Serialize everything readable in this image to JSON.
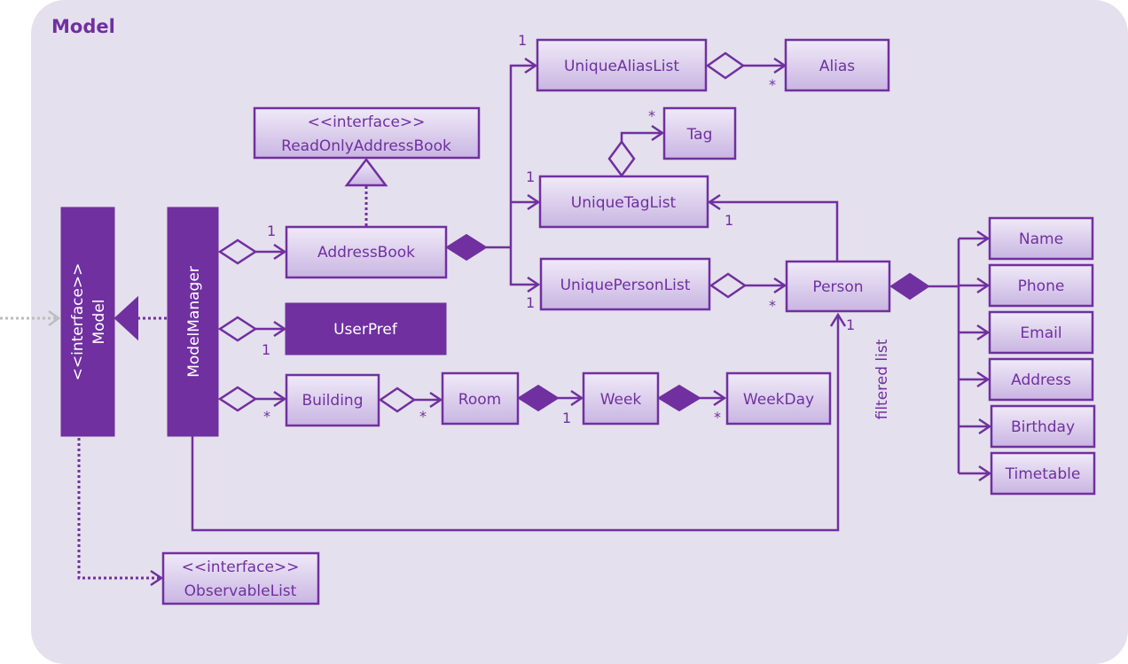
{
  "package": {
    "title": "Model"
  },
  "colors": {
    "accent": "#7030a0",
    "package_bg": "#e5e0ed",
    "box_top": "#f0eaf8",
    "box_bottom": "#c9b5e2",
    "external_arrow": "#bdbdbd"
  },
  "classes": {
    "model": {
      "stereotype": "<<interface>>",
      "name": "Model"
    },
    "model_manager": {
      "name": "ModelManager"
    },
    "read_only_address_book": {
      "stereotype": "<<interface>>",
      "name": "ReadOnlyAddressBook"
    },
    "address_book": {
      "name": "AddressBook"
    },
    "user_pref": {
      "name": "UserPref"
    },
    "building": {
      "name": "Building"
    },
    "room": {
      "name": "Room"
    },
    "week": {
      "name": "Week"
    },
    "week_day": {
      "name": "WeekDay"
    },
    "unique_alias_list": {
      "name": "UniqueAliasList"
    },
    "alias": {
      "name": "Alias"
    },
    "tag": {
      "name": "Tag"
    },
    "unique_tag_list": {
      "name": "UniqueTagList"
    },
    "unique_person_list": {
      "name": "UniquePersonList"
    },
    "person": {
      "name": "Person"
    },
    "name": {
      "name": "Name"
    },
    "phone": {
      "name": "Phone"
    },
    "email": {
      "name": "Email"
    },
    "address": {
      "name": "Address"
    },
    "birthday": {
      "name": "Birthday"
    },
    "timetable": {
      "name": "Timetable"
    },
    "observable_list": {
      "stereotype": "<<interface>>",
      "name": "ObservableList"
    }
  },
  "multiplicities": {
    "mm_addressbook": "1",
    "mm_userpref": "1",
    "mm_building": "*",
    "building_room": "*",
    "room_week": "1",
    "week_weekday": "*",
    "ab_aliaslist": "1",
    "aliaslist_alias": "*",
    "taglist_tag": "*",
    "ab_taglist": "1",
    "person_taglist": "1",
    "ab_personlist": "1",
    "personlist_person": "*",
    "mm_person": "1"
  },
  "association_labels": {
    "filtered_list": "filtered list"
  }
}
